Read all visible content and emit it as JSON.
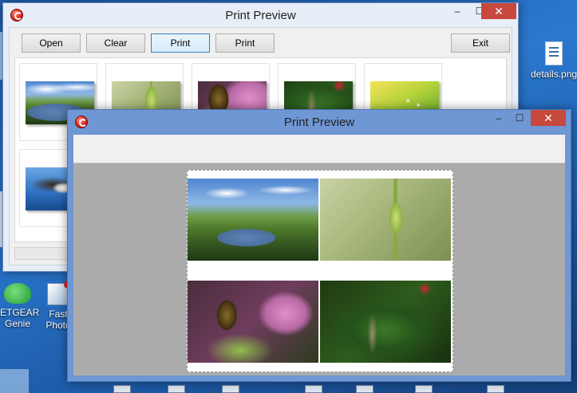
{
  "desktop": {
    "icons": [
      {
        "label": "details.png",
        "glyph": "document-icon"
      },
      {
        "label_line1": "ETGEAR",
        "label_line2": "Genie",
        "glyph": "genie-lamp-icon"
      },
      {
        "label_line1": "Fast",
        "label_line2": "Photo",
        "glyph": "photo-app-icon"
      }
    ]
  },
  "back_window": {
    "title": "Print Preview",
    "controls": {
      "minimize": "–",
      "maximize": "☐",
      "close": "✕"
    },
    "toolbar": {
      "open_label": "Open",
      "clear_label": "Clear",
      "print1_label": "Print",
      "print2_label": "Print",
      "exit_label": "Exit"
    },
    "thumbnails": [
      "lake-landscape",
      "flower-bud",
      "butterfly",
      "dragonfly",
      "green-leaf",
      "eagle"
    ]
  },
  "front_window": {
    "title": "Print Preview",
    "controls": {
      "minimize": "–",
      "maximize": "☐",
      "close": "✕"
    },
    "page_images": [
      "lake-landscape",
      "flower-bud",
      "butterfly",
      "dragonfly"
    ]
  }
}
